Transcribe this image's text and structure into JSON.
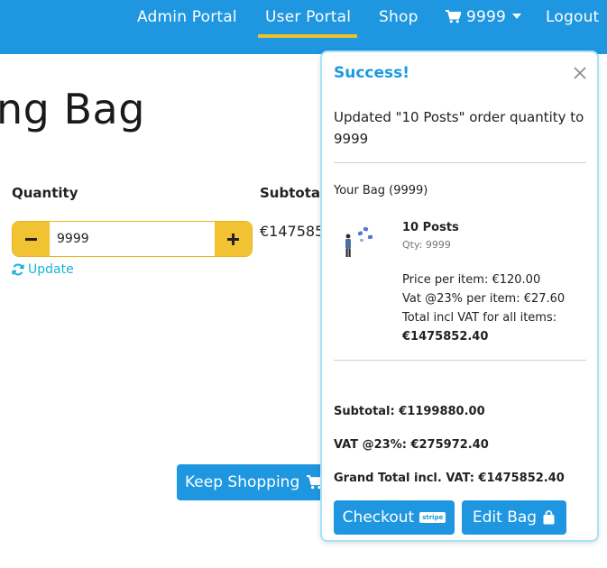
{
  "nav": {
    "items": [
      {
        "label": "Admin Portal"
      },
      {
        "label": "User Portal"
      },
      {
        "label": "Shop"
      },
      {
        "label": "9999"
      },
      {
        "label": "Logout"
      }
    ],
    "active_color": "#f0c028",
    "bg_color": "#1e96e0"
  },
  "page": {
    "title": "ng Bag",
    "quantity_label": "Quantity",
    "subtotal_label": "Subtotal",
    "quantity_value": "9999",
    "update_label": "Update",
    "subtotal_value": "€147585",
    "keep_shopping_label": "Keep Shopping"
  },
  "toast": {
    "title": "Success!",
    "message": "Updated \"10 Posts\" order quantity to 9999",
    "bag_label": "Your Bag (9999)",
    "item": {
      "name": "10 Posts",
      "qty": "Qty: 9999",
      "price_per_item": "Price per item: €120.00",
      "vat_per_item": "Vat @23% per item: €27.60",
      "total_label": "Total incl VAT for all items:",
      "total_value": "€1475852.40"
    },
    "subtotal": "Subtotal: €1199880.00",
    "vat": "VAT @23%: €275972.40",
    "grand_total": "Grand Total incl. VAT: €1475852.40",
    "checkout_label": "Checkout",
    "stripe_badge": "stripe",
    "edit_bag_label": "Edit Bag",
    "accent_color": "#1a9be0"
  }
}
